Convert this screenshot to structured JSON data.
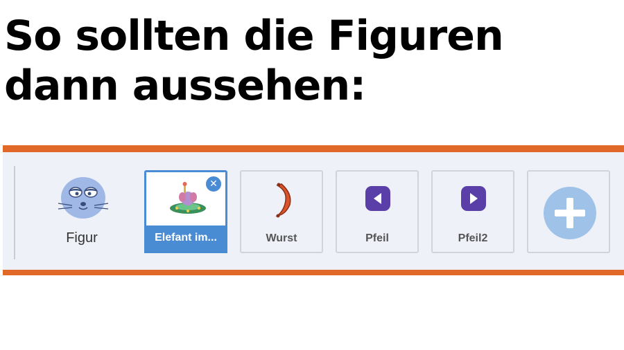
{
  "headline": "So sollten die Figuren dann aussehen:",
  "stage": {
    "label": "Figur"
  },
  "sprites": [
    {
      "label": "Elefant im...",
      "selected": true,
      "icon": "elephant-ufo-icon"
    },
    {
      "label": "Wurst",
      "selected": false,
      "icon": "sausage-icon"
    },
    {
      "label": "Pfeil",
      "selected": false,
      "icon": "arrow-left-icon"
    },
    {
      "label": "Pfeil2",
      "selected": false,
      "icon": "arrow-right-icon"
    }
  ],
  "add_button": {
    "icon": "plus-icon"
  },
  "colors": {
    "accent": "#e0692a",
    "selected": "#4a8cd4",
    "panel": "#eef1f7",
    "arrow": "#5a3fa8",
    "sausage": "#d9542a",
    "add": "#9fc2e8"
  }
}
